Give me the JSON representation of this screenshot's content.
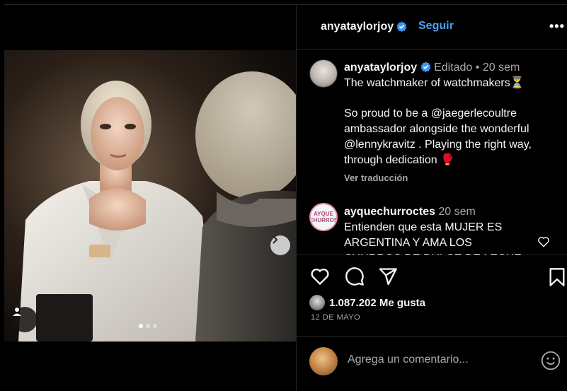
{
  "header": {
    "username": "anyataylorjoy",
    "follow_label": "Seguir",
    "more_label": "•••"
  },
  "caption": {
    "username": "anyataylorjoy",
    "edited": "Editado",
    "separator": "•",
    "time": "20 sem",
    "line1": "The watchmaker of watchmakers⏳",
    "line2": "So proud to be a @jaegerlecoultre ambassador alongside the wonderful @lennykravitz . Playing the right way, through dedication 🥊",
    "translate_label": "Ver traducción"
  },
  "comment": {
    "username": "ayquechurroctes",
    "time": "20 sem",
    "avatar_text": "AYQUE CHURROS",
    "text": "Entienden que esta MUJER ES ARGENTINA Y AMA LOS CHURROS DE DULCE DE LECHE 💖"
  },
  "post": {
    "likes": "1.087.202 Me gusta",
    "date": "12 DE MAYO",
    "carousel_count": 3,
    "carousel_active": 1
  },
  "composer": {
    "placeholder": "Agrega un comentario..."
  },
  "colors": {
    "accent": "#4aa3f3",
    "verified": "#3897f0",
    "muted": "#a8a8a8",
    "border": "#262626"
  },
  "icons": [
    "verified-icon",
    "more-icon",
    "chevron-right-icon",
    "user-tag-icon",
    "heart-icon",
    "comment-icon",
    "share-icon",
    "bookmark-icon",
    "emoji-icon"
  ]
}
